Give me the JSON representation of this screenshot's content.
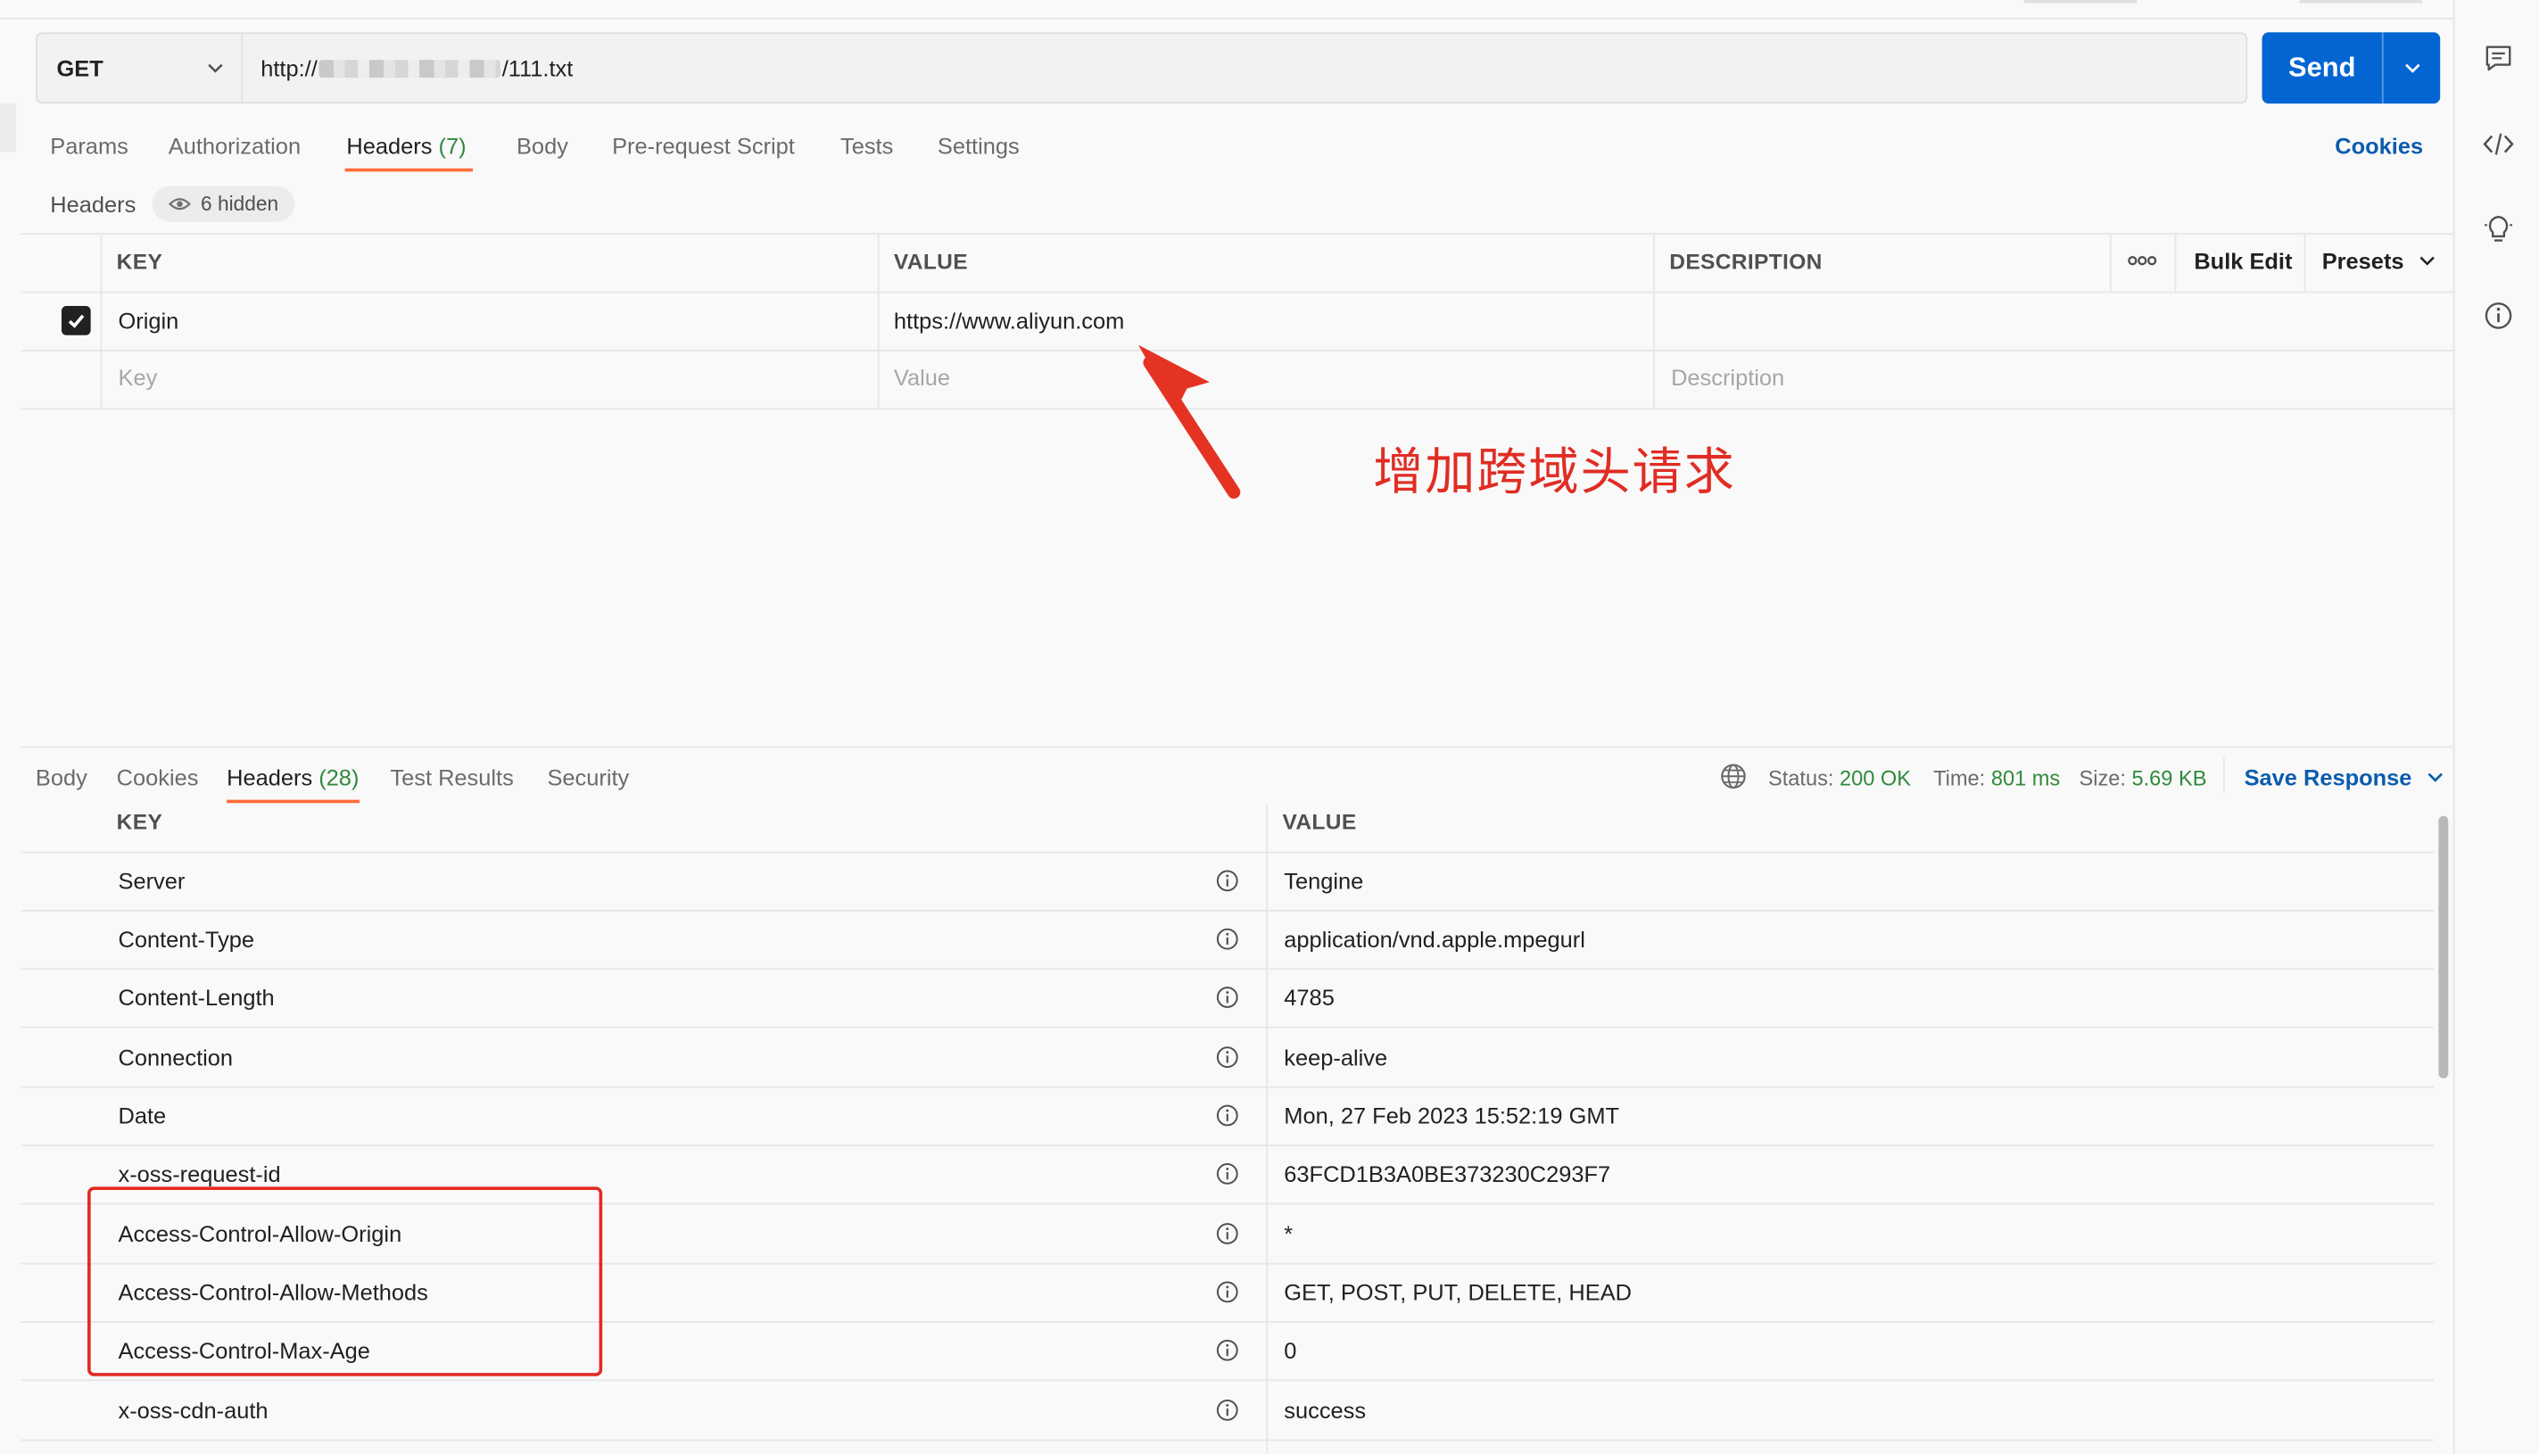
{
  "request": {
    "method": "GET",
    "url_prefix": "http://",
    "url_suffix": "/111.txt",
    "send_label": "Send"
  },
  "request_tabs": [
    {
      "label": "Params"
    },
    {
      "label": "Authorization"
    },
    {
      "label": "Headers",
      "count": "(7)",
      "active": true
    },
    {
      "label": "Body"
    },
    {
      "label": "Pre-request Script"
    },
    {
      "label": "Tests"
    },
    {
      "label": "Settings"
    }
  ],
  "cookies_label": "Cookies",
  "headers_section": {
    "title": "Headers",
    "hidden_label": "6 hidden"
  },
  "request_table": {
    "columns": {
      "key": "KEY",
      "value": "VALUE",
      "description": "DESCRIPTION"
    },
    "bulk_edit": "Bulk Edit",
    "presets": "Presets",
    "rows": [
      {
        "checked": true,
        "key": "Origin",
        "value": "https://www.aliyun.com",
        "description": ""
      }
    ],
    "placeholders": {
      "key": "Key",
      "value": "Value",
      "description": "Description"
    }
  },
  "annotation": {
    "text": "增加跨域头请求",
    "color": "#e02d24"
  },
  "response_tabs": [
    {
      "label": "Body"
    },
    {
      "label": "Cookies"
    },
    {
      "label": "Headers",
      "count": "(28)",
      "active": true
    },
    {
      "label": "Test Results"
    },
    {
      "label": "Security"
    }
  ],
  "response_meta": {
    "status_label": "Status:",
    "status_value": "200 OK",
    "time_label": "Time:",
    "time_value": "801 ms",
    "size_label": "Size:",
    "size_value": "5.69 KB",
    "save_response": "Save Response"
  },
  "response_table": {
    "columns": {
      "key": "KEY",
      "value": "VALUE"
    },
    "rows": [
      {
        "key": "Server",
        "value": "Tengine"
      },
      {
        "key": "Content-Type",
        "value": "application/vnd.apple.mpegurl"
      },
      {
        "key": "Content-Length",
        "value": "4785"
      },
      {
        "key": "Connection",
        "value": "keep-alive"
      },
      {
        "key": "Date",
        "value": "Mon, 27 Feb 2023 15:52:19 GMT"
      },
      {
        "key": "x-oss-request-id",
        "value": "63FCD1B3A0BE373230C293F7"
      },
      {
        "key": "Access-Control-Allow-Origin",
        "value": "*"
      },
      {
        "key": "Access-Control-Allow-Methods",
        "value": "GET, POST, PUT, DELETE, HEAD"
      },
      {
        "key": "Access-Control-Max-Age",
        "value": "0"
      },
      {
        "key": "x-oss-cdn-auth",
        "value": "success"
      }
    ]
  },
  "colors": {
    "accent": "#ff6c37",
    "send_blue": "#0265d2",
    "link_blue": "#0b5cad",
    "success_green": "#2f8a3c",
    "highlight_red": "#e22b22"
  }
}
